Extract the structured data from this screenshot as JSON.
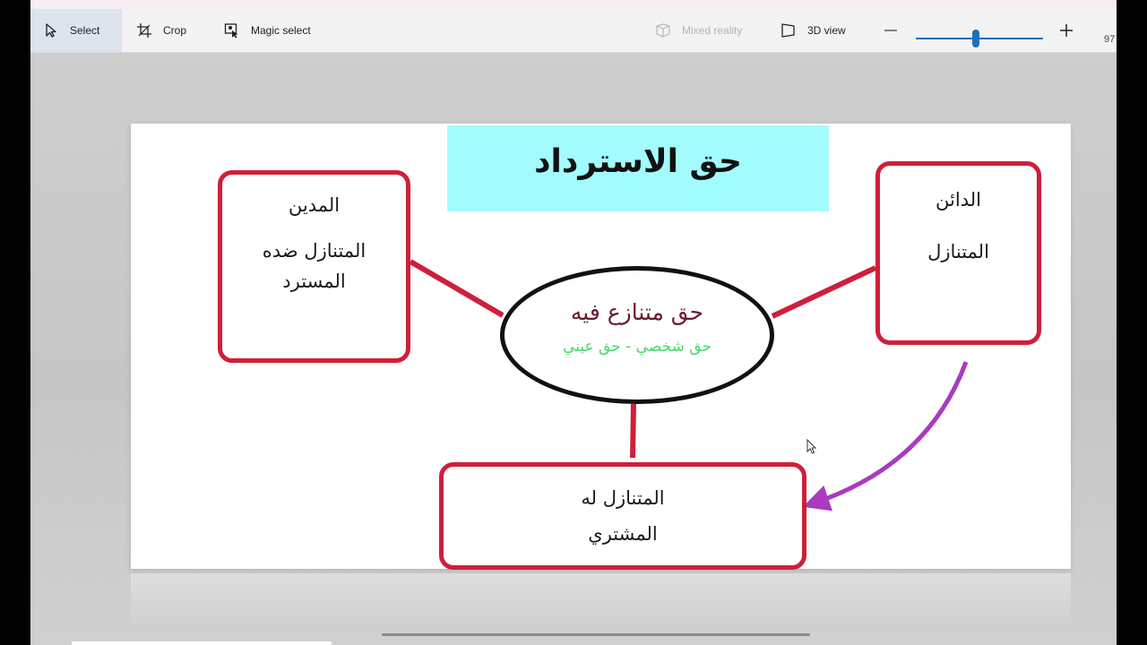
{
  "toolbar": {
    "select_label": "Select",
    "crop_label": "Crop",
    "magic_select_label": "Magic select",
    "mixed_reality_label": "Mixed reality",
    "view_3d_label": "3D view",
    "zoom_value": "97",
    "zoom_level": 0.47,
    "icons": [
      "select-cursor-icon",
      "crop-icon",
      "magic-select-icon",
      "mixed-reality-icon",
      "3d-view-icon",
      "minus-icon",
      "plus-icon"
    ],
    "accent_color": "#1d6fb8",
    "selected_tool_bg": "#dde4ed"
  },
  "diagram": {
    "title": "حق الاسترداد",
    "center_main": "حق متنازع فيه",
    "center_sub": "حق شخصي - حق عيني",
    "debtor": {
      "line1": "المدين",
      "line2": "المتنازل ضده",
      "line3": "المسترد"
    },
    "creditor": {
      "line1": "الدائن",
      "line2": "المتنازل"
    },
    "assignee": {
      "line1": "المتنازل له",
      "line2": "المشتري"
    },
    "colors": {
      "title_bg": "#a2fbfd",
      "box_border": "#cf1f3a",
      "connector": "#cf1f3a",
      "arrow": "#a83bc0",
      "center_text": "#6b1a2c",
      "center_sub_text": "#45d96a"
    }
  }
}
